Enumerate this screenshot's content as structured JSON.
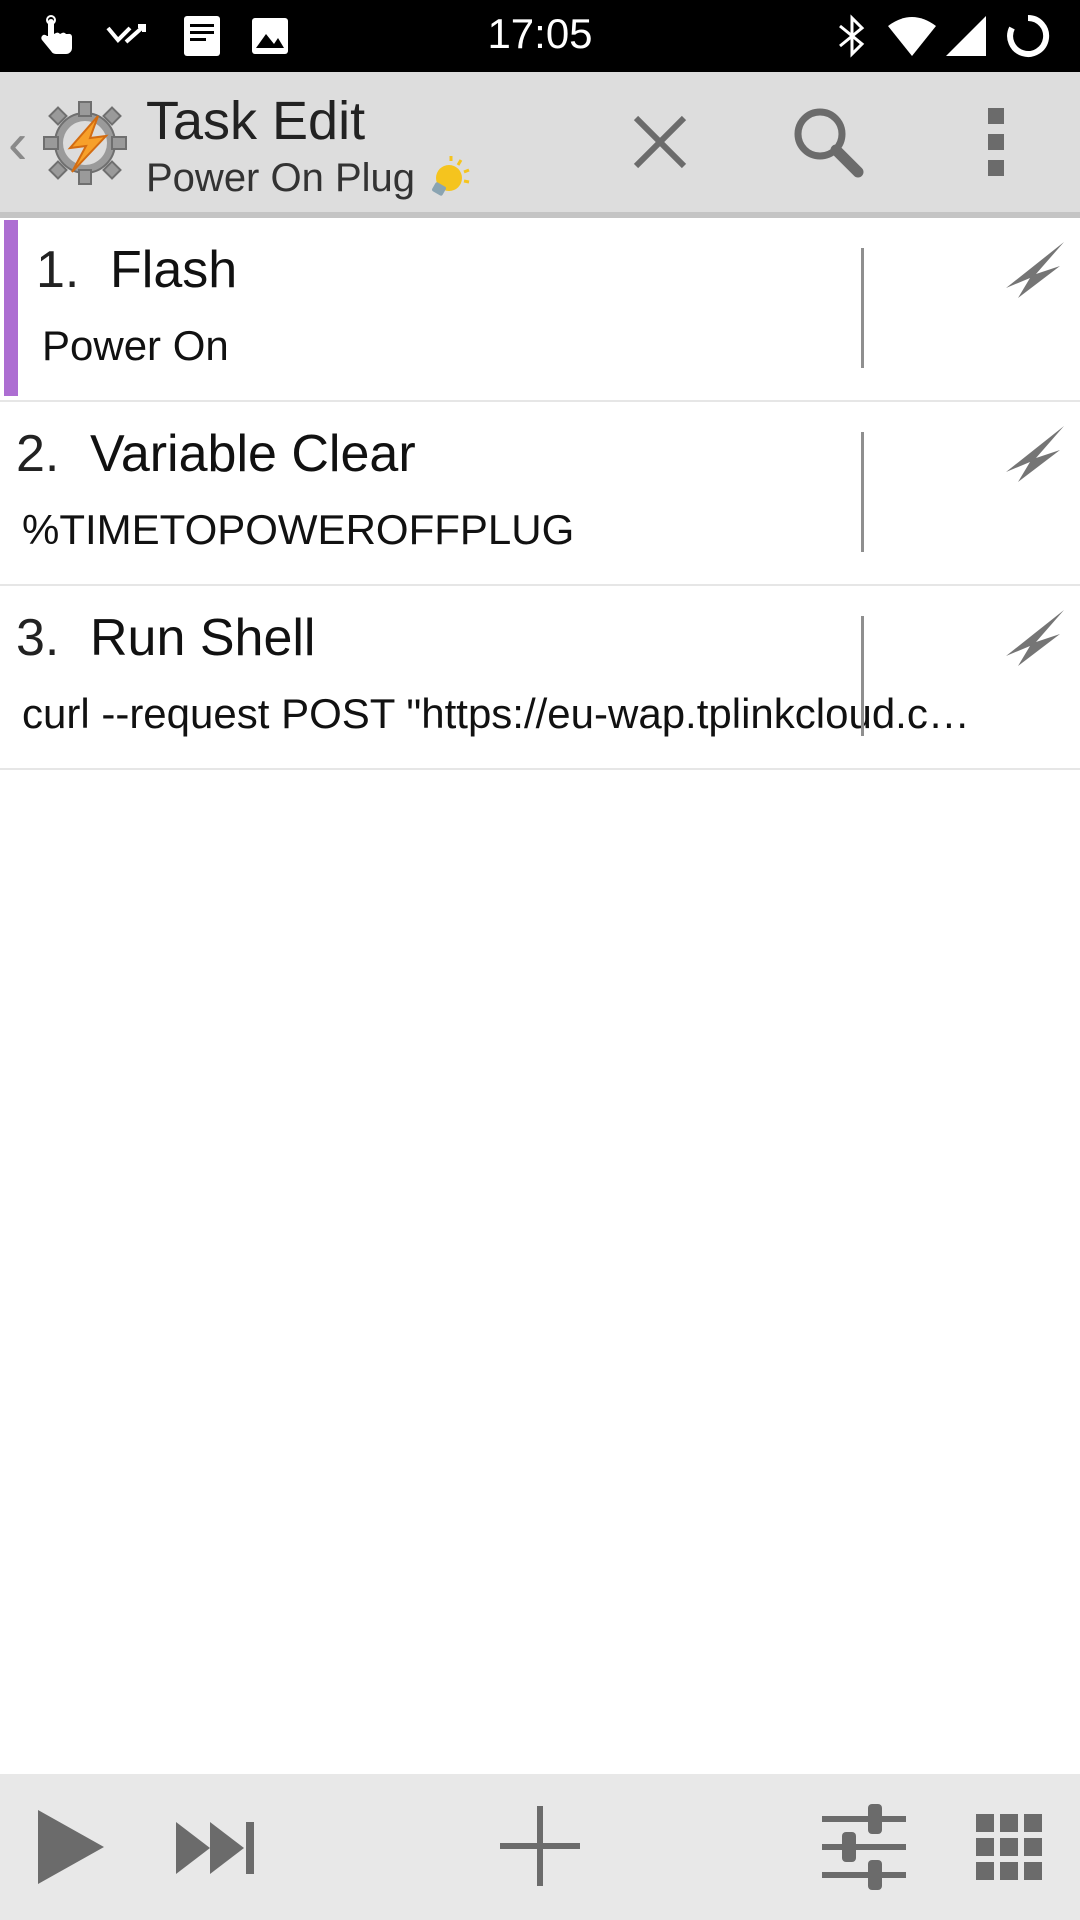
{
  "status_bar": {
    "time": "17:05",
    "left_icons": [
      "touch-notification-icon",
      "missed-call-icon",
      "document-notification-icon",
      "image-notification-icon"
    ],
    "right_icons": [
      "bluetooth-icon",
      "wifi-icon",
      "cell-signal-icon",
      "sync-icon"
    ]
  },
  "action_bar": {
    "title": "Task Edit",
    "subtitle": "Power On Plug",
    "subtitle_icon": "light-bulb-icon",
    "buttons": [
      "close-icon",
      "search-icon",
      "overflow-menu-icon"
    ]
  },
  "actions": [
    {
      "number": "1.",
      "name": "Flash",
      "detail": "Power On",
      "selected": true
    },
    {
      "number": "2.",
      "name": "Variable Clear",
      "detail": "%TIMETOPOWEROFFPLUG",
      "selected": false
    },
    {
      "number": "3.",
      "name": "Run Shell",
      "detail": "curl --request POST \"https://eu-wap.tplinkcloud.com/?token=",
      "selected": false
    }
  ],
  "bottom_bar": {
    "buttons": [
      "play-icon",
      "skip-forward-icon",
      "add-icon",
      "settings-sliders-icon",
      "grid-icon"
    ]
  },
  "colors": {
    "status_bar": "#000000",
    "action_bar": "#dddddd",
    "selection_accent": "#ad6ed2",
    "bottom_bar": "#e8e8e8",
    "icon_gray": "#6b6b6b"
  }
}
